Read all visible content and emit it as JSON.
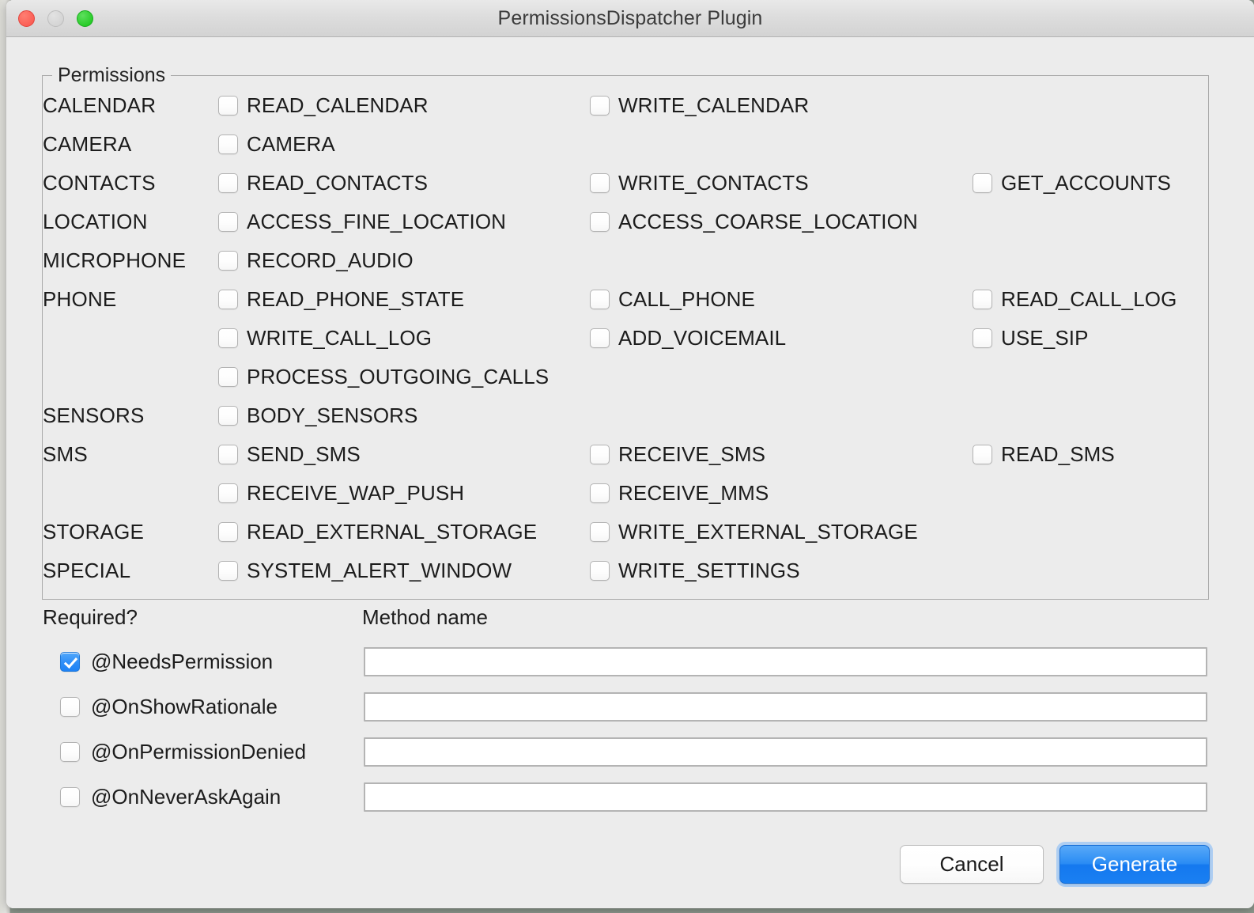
{
  "window": {
    "title": "PermissionsDispatcher Plugin",
    "traffic_lights": [
      "close-button",
      "minimize-button",
      "maximize-button"
    ]
  },
  "permissions": {
    "legend": "Permissions",
    "rows": [
      {
        "group": "CALENDAR",
        "cells": [
          {
            "label": "READ_CALENDAR",
            "checked": false
          },
          {
            "label": "WRITE_CALENDAR",
            "checked": false
          },
          null
        ]
      },
      {
        "group": "CAMERA",
        "cells": [
          {
            "label": "CAMERA",
            "checked": false
          },
          null,
          null
        ]
      },
      {
        "group": "CONTACTS",
        "cells": [
          {
            "label": "READ_CONTACTS",
            "checked": false
          },
          {
            "label": "WRITE_CONTACTS",
            "checked": false
          },
          {
            "label": "GET_ACCOUNTS",
            "checked": false
          }
        ]
      },
      {
        "group": "LOCATION",
        "cells": [
          {
            "label": "ACCESS_FINE_LOCATION",
            "checked": false
          },
          {
            "label": "ACCESS_COARSE_LOCATION",
            "checked": false
          },
          null
        ]
      },
      {
        "group": "MICROPHONE",
        "cells": [
          {
            "label": "RECORD_AUDIO",
            "checked": false
          },
          null,
          null
        ]
      },
      {
        "group": "PHONE",
        "cells": [
          {
            "label": "READ_PHONE_STATE",
            "checked": false
          },
          {
            "label": "CALL_PHONE",
            "checked": false
          },
          {
            "label": "READ_CALL_LOG",
            "checked": false
          }
        ]
      },
      {
        "group": "",
        "cells": [
          {
            "label": "WRITE_CALL_LOG",
            "checked": false
          },
          {
            "label": "ADD_VOICEMAIL",
            "checked": false
          },
          {
            "label": "USE_SIP",
            "checked": false
          }
        ]
      },
      {
        "group": "",
        "cells": [
          {
            "label": "PROCESS_OUTGOING_CALLS",
            "checked": false
          },
          null,
          null
        ]
      },
      {
        "group": "SENSORS",
        "cells": [
          {
            "label": "BODY_SENSORS",
            "checked": false
          },
          null,
          null
        ]
      },
      {
        "group": "SMS",
        "cells": [
          {
            "label": "SEND_SMS",
            "checked": false
          },
          {
            "label": "RECEIVE_SMS",
            "checked": false
          },
          {
            "label": "READ_SMS",
            "checked": false
          }
        ]
      },
      {
        "group": "",
        "cells": [
          {
            "label": "RECEIVE_WAP_PUSH",
            "checked": false
          },
          {
            "label": "RECEIVE_MMS",
            "checked": false
          },
          null
        ]
      },
      {
        "group": "STORAGE",
        "cells": [
          {
            "label": "READ_EXTERNAL_STORAGE",
            "checked": false
          },
          {
            "label": "WRITE_EXTERNAL_STORAGE",
            "checked": false
          },
          null
        ]
      },
      {
        "group": "SPECIAL",
        "cells": [
          {
            "label": "SYSTEM_ALERT_WINDOW",
            "checked": false
          },
          {
            "label": "WRITE_SETTINGS",
            "checked": false
          },
          null
        ]
      }
    ]
  },
  "form": {
    "required_header": "Required?",
    "method_name_header": "Method name",
    "rows": [
      {
        "annotation": "@NeedsPermission",
        "checked": true,
        "method_name": "",
        "placeholder": ""
      },
      {
        "annotation": "@OnShowRationale",
        "checked": false,
        "method_name": "",
        "placeholder": ""
      },
      {
        "annotation": "@OnPermissionDenied",
        "checked": false,
        "method_name": "",
        "placeholder": ""
      },
      {
        "annotation": "@OnNeverAskAgain",
        "checked": false,
        "method_name": "",
        "placeholder": ""
      }
    ]
  },
  "footer": {
    "cancel_label": "Cancel",
    "generate_label": "Generate"
  },
  "colors": {
    "accent": "#1d82f5",
    "window_background": "#ececec",
    "text": "#1c1c1c",
    "border": "#a9a9a9",
    "close_light": "#f9534a",
    "minimize_light": "#cfcfcf",
    "maximize_light": "#15c415"
  }
}
